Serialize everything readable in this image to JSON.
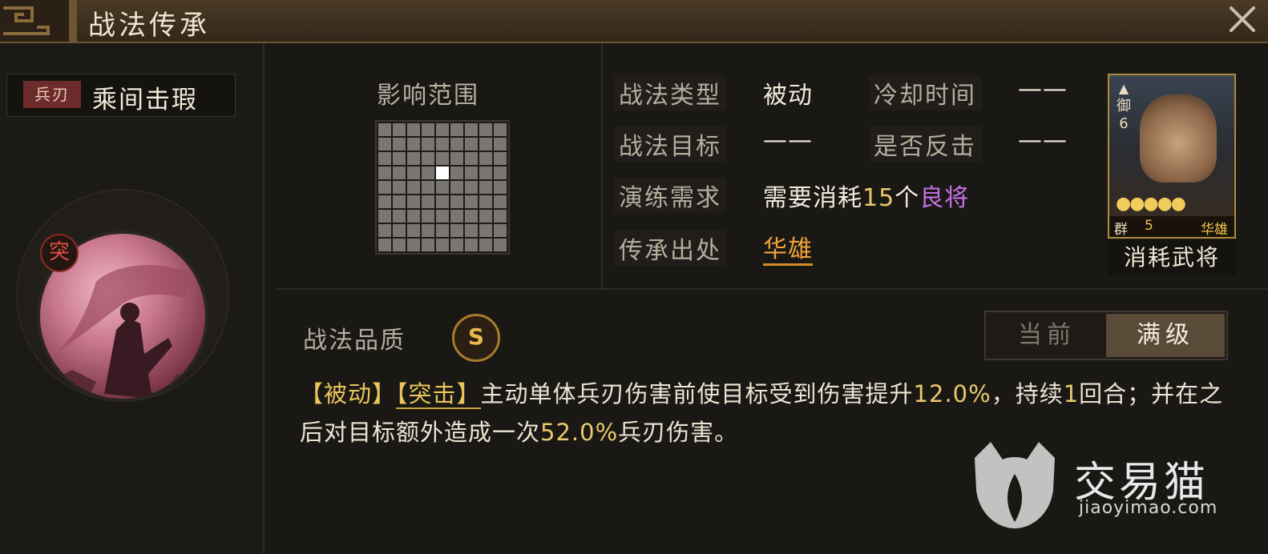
{
  "window": {
    "title": "战法传承",
    "close_icon": "close-icon"
  },
  "skill": {
    "type_tag": "兵刃",
    "name": "乘间击瑕",
    "badge": "突"
  },
  "range": {
    "label": "影响范围",
    "grid_size": 9,
    "center_cell": [
      4,
      3
    ]
  },
  "fields": {
    "type_label": "战法类型",
    "type_value": "被动",
    "cooldown_label": "冷却时间",
    "cooldown_value": "——",
    "target_label": "战法目标",
    "target_value": "——",
    "counter_label": "是否反击",
    "counter_value": "——",
    "requirement_label": "演练需求",
    "requirement_prefix": "需要消耗",
    "requirement_count": "15",
    "requirement_mid": "个",
    "requirement_item": "良将",
    "origin_label": "传承出处",
    "origin_value": "华雄"
  },
  "general_card": {
    "rank_top": "御",
    "rank_num": "6",
    "stars": "●●●●●",
    "faction": "群",
    "cost": "5",
    "name": "华雄",
    "caption": "消耗武将"
  },
  "quality": {
    "label": "战法品质",
    "grade": "S"
  },
  "level_switch": {
    "current": "当前",
    "max": "满级",
    "selected": "max"
  },
  "description": {
    "tag1": "【被动】",
    "tag2": "【突击】",
    "text1": "主动单体兵刃伤害前使目标受到伤害提升",
    "value1": "12.0%",
    "text2": "，持续",
    "value2": "1",
    "text3": "回合；并在之后对目标额外造成一次",
    "value3": "52.0%",
    "text4": "兵刃伤害。"
  },
  "watermark": {
    "name": "交易猫",
    "url": "jiaoyimao.com"
  },
  "colors": {
    "accent_gold": "#e9c55a",
    "accent_purple": "#c671e6",
    "origin_orange": "#f2a23a",
    "tag_red": "#6e2b2b"
  }
}
